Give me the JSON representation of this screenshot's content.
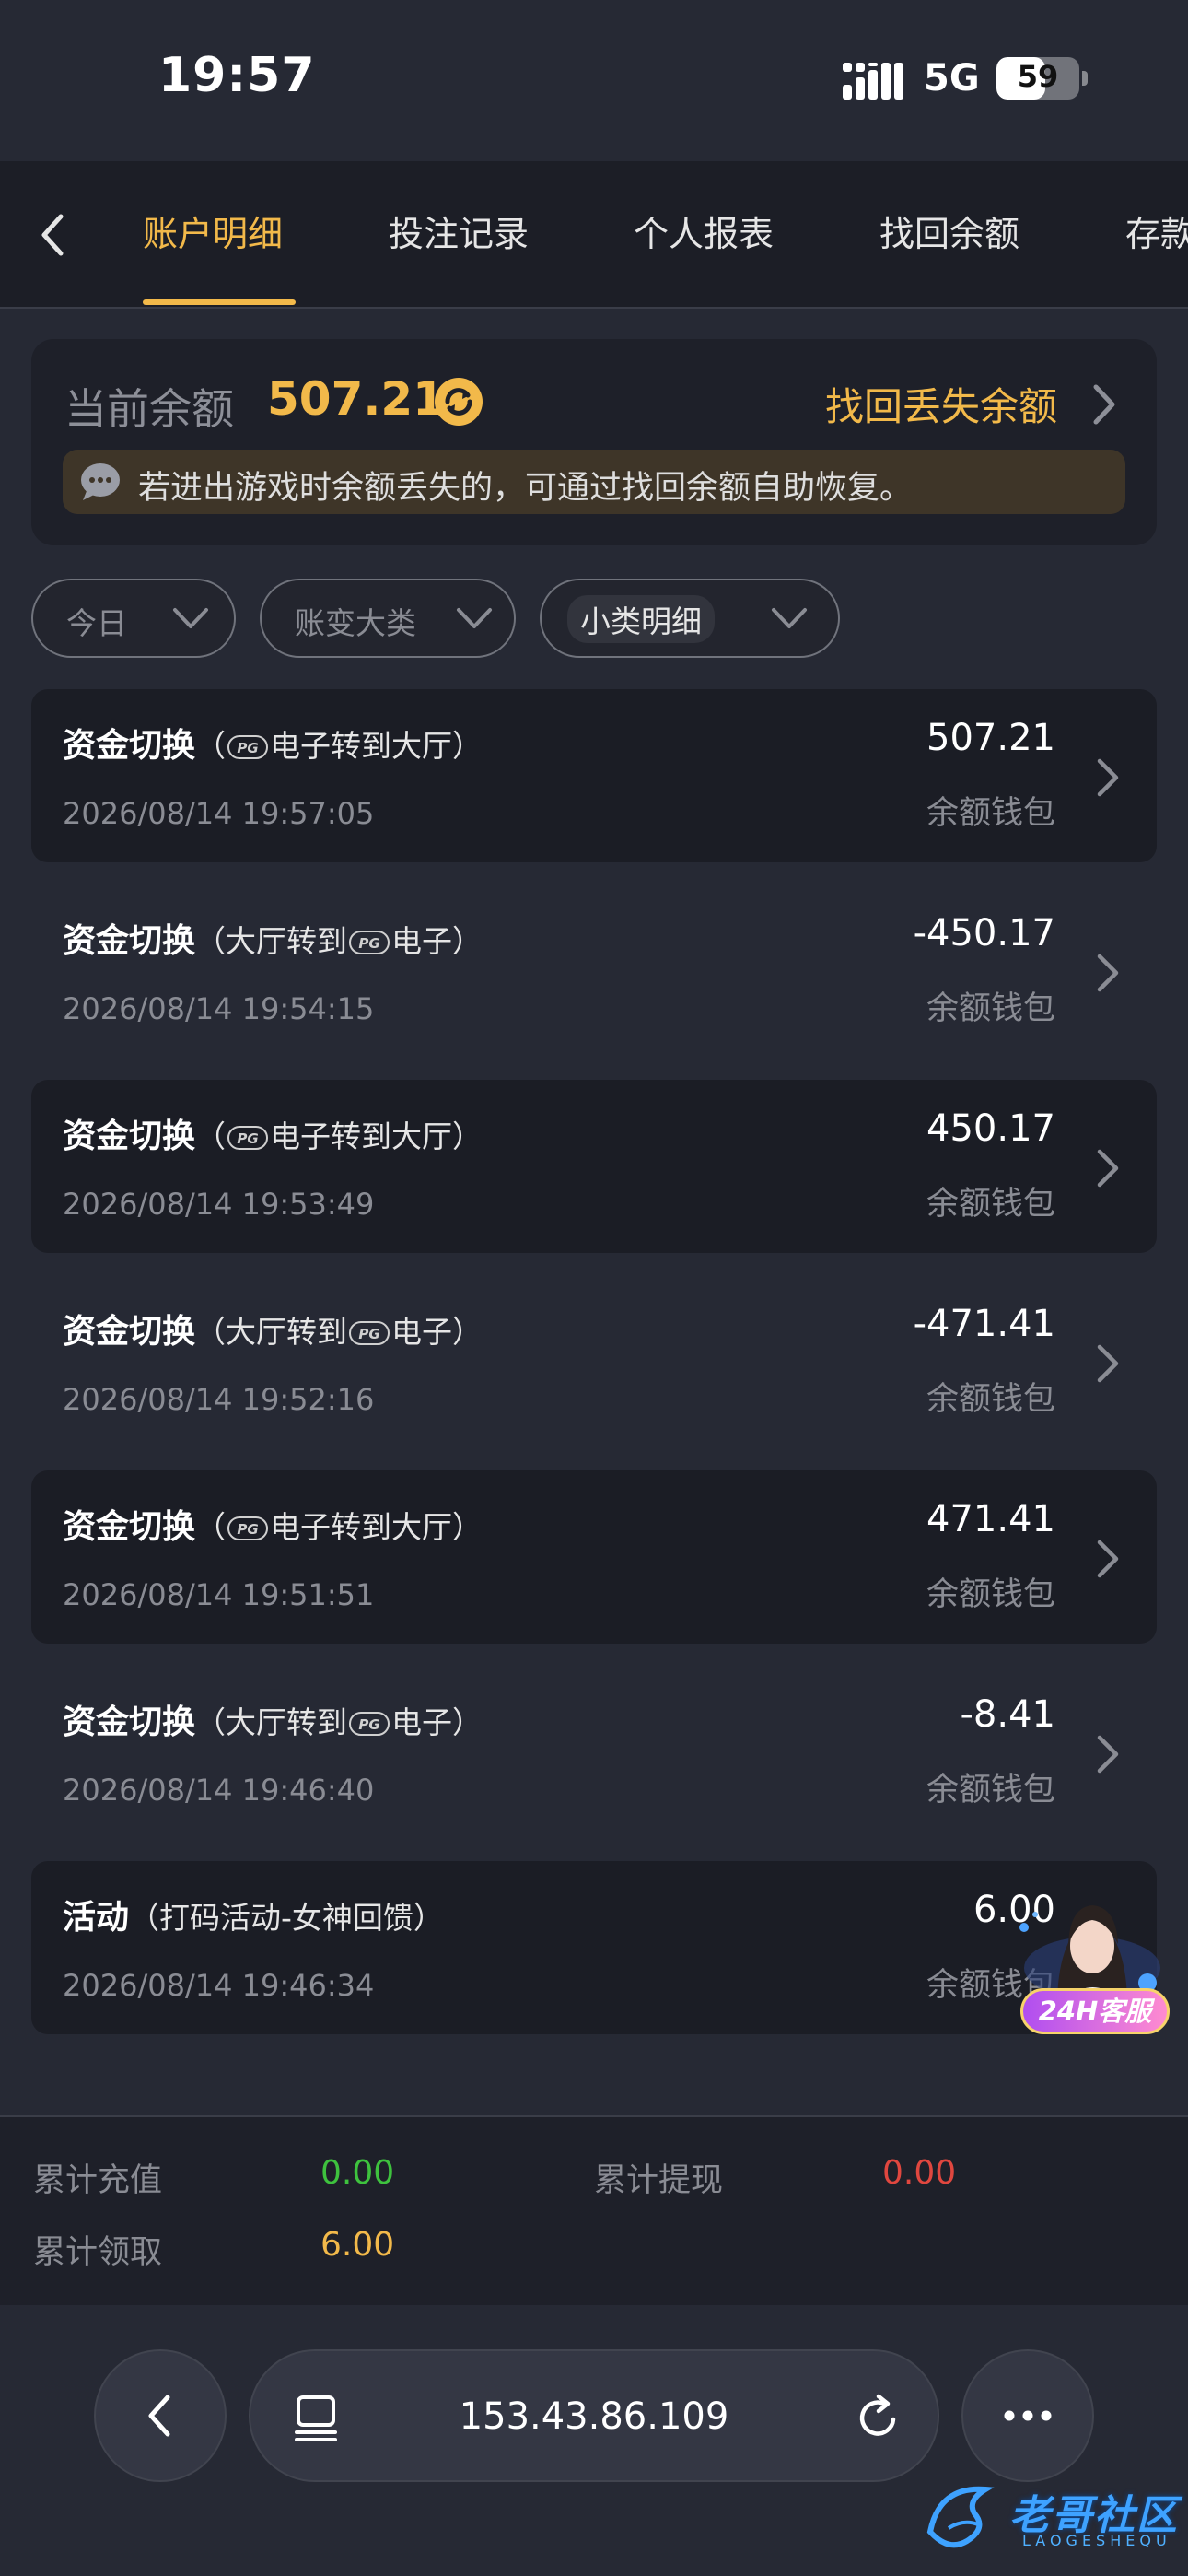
{
  "status_bar": {
    "time": "19:57",
    "network": "5G",
    "battery": "59",
    "battery_level": 0.59
  },
  "tabs": [
    {
      "label": "账户明细",
      "active": true
    },
    {
      "label": "投注记录",
      "active": false
    },
    {
      "label": "个人报表",
      "active": false
    },
    {
      "label": "找回余额",
      "active": false
    },
    {
      "label": "存款",
      "active": false
    }
  ],
  "balance": {
    "label": "当前余额",
    "value": "507.21",
    "recover_link": "找回丢失余额",
    "notice": "若进出游戏时余额丢失的，可通过找回余额自助恢复。"
  },
  "filters": [
    {
      "label": "今日"
    },
    {
      "label": "账变大类"
    },
    {
      "label": "小类明细"
    }
  ],
  "records": [
    {
      "type": "资金切换",
      "detail_pre": "（",
      "detail_post": "电子转到大厅）",
      "logo_first": true,
      "time": "2026/08/14 19:57:05",
      "amount": "507.21",
      "wallet": "余额钱包"
    },
    {
      "type": "资金切换",
      "detail_pre": "（大厅转到",
      "detail_post": "电子）",
      "logo_first": false,
      "time": "2026/08/14 19:54:15",
      "amount": "-450.17",
      "wallet": "余额钱包"
    },
    {
      "type": "资金切换",
      "detail_pre": "（",
      "detail_post": "电子转到大厅）",
      "logo_first": true,
      "time": "2026/08/14 19:53:49",
      "amount": "450.17",
      "wallet": "余额钱包"
    },
    {
      "type": "资金切换",
      "detail_pre": "（大厅转到",
      "detail_post": "电子）",
      "logo_first": false,
      "time": "2026/08/14 19:52:16",
      "amount": "-471.41",
      "wallet": "余额钱包"
    },
    {
      "type": "资金切换",
      "detail_pre": "（",
      "detail_post": "电子转到大厅）",
      "logo_first": true,
      "time": "2026/08/14 19:51:51",
      "amount": "471.41",
      "wallet": "余额钱包"
    },
    {
      "type": "资金切换",
      "detail_pre": "（大厅转到",
      "detail_post": "电子）",
      "logo_first": false,
      "time": "2026/08/14 19:46:40",
      "amount": "-8.41",
      "wallet": "余额钱包"
    },
    {
      "type": "活动",
      "detail_pre": "（打码活动-女神回馈）",
      "detail_post": "",
      "logo_first": false,
      "no_logo": true,
      "time": "2026/08/14 19:46:34",
      "amount": "6.00",
      "wallet": "余额钱包"
    }
  ],
  "support": {
    "label": "24H客服"
  },
  "summary": {
    "deposit_label": "累计充值",
    "deposit_value": "0.00",
    "withdraw_label": "累计提现",
    "withdraw_value": "0.00",
    "claim_label": "累计领取",
    "claim_value": "6.00"
  },
  "browser": {
    "url": "153.43.86.109"
  },
  "watermark": {
    "text": "老哥社区",
    "sub": "LAOGESHEQU"
  },
  "colors": {
    "accent": "#f2b94a",
    "positive": "#3ec23e",
    "negative": "#e0473f",
    "background": "#262934"
  }
}
